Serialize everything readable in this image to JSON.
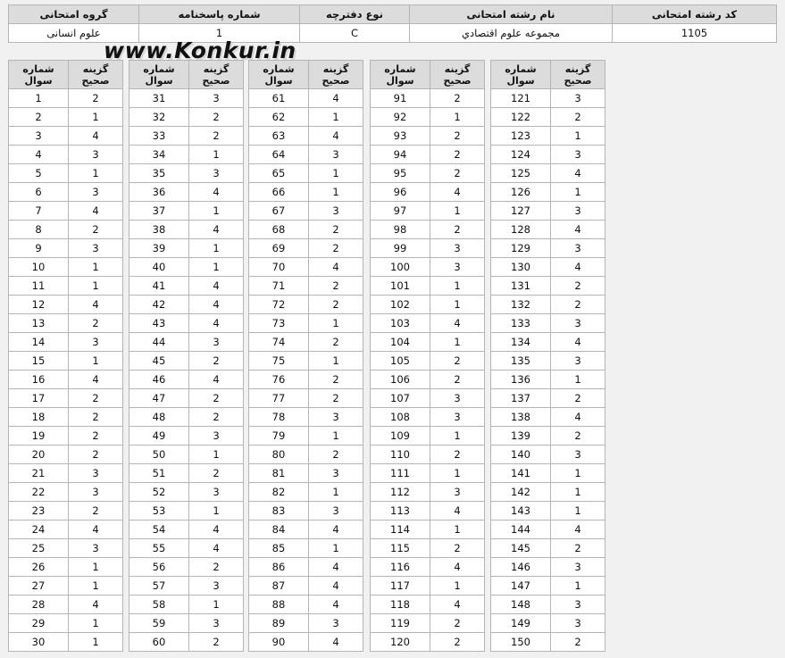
{
  "info": {
    "headers": [
      "کد رشته امتحانی",
      "نام رشته امتحانی",
      "نوع دفترچه",
      "شماره پاسخنامه",
      "گروه امتحانی"
    ],
    "values": [
      "1105",
      "مجموعه علوم اقتصادي",
      "C",
      "1",
      "علوم انسانی"
    ]
  },
  "watermark": "www.Konkur.in",
  "answers": {
    "col_question": "شماره سوال",
    "col_answer": "گزینه صحیح",
    "list": [
      2,
      1,
      4,
      3,
      1,
      3,
      4,
      2,
      3,
      1,
      1,
      4,
      2,
      3,
      1,
      4,
      2,
      2,
      2,
      2,
      3,
      3,
      2,
      4,
      3,
      1,
      1,
      4,
      1,
      1,
      3,
      2,
      2,
      1,
      3,
      4,
      1,
      4,
      1,
      1,
      4,
      4,
      4,
      3,
      2,
      4,
      2,
      2,
      3,
      1,
      2,
      3,
      1,
      4,
      4,
      2,
      3,
      1,
      3,
      2,
      4,
      1,
      4,
      3,
      1,
      1,
      3,
      2,
      2,
      4,
      2,
      2,
      1,
      2,
      1,
      2,
      2,
      3,
      1,
      2,
      3,
      1,
      3,
      4,
      1,
      4,
      4,
      4,
      3,
      4,
      2,
      1,
      2,
      2,
      2,
      4,
      1,
      2,
      3,
      3,
      1,
      1,
      4,
      1,
      2,
      2,
      3,
      3,
      1,
      2,
      1,
      3,
      4,
      1,
      2,
      4,
      1,
      4,
      2,
      2,
      3,
      2,
      1,
      3,
      4,
      1,
      3,
      4,
      3,
      4,
      2,
      2,
      3,
      4,
      3,
      1,
      2,
      4,
      2,
      3,
      1,
      1,
      1,
      4,
      2,
      3,
      1,
      3,
      3,
      2
    ]
  }
}
